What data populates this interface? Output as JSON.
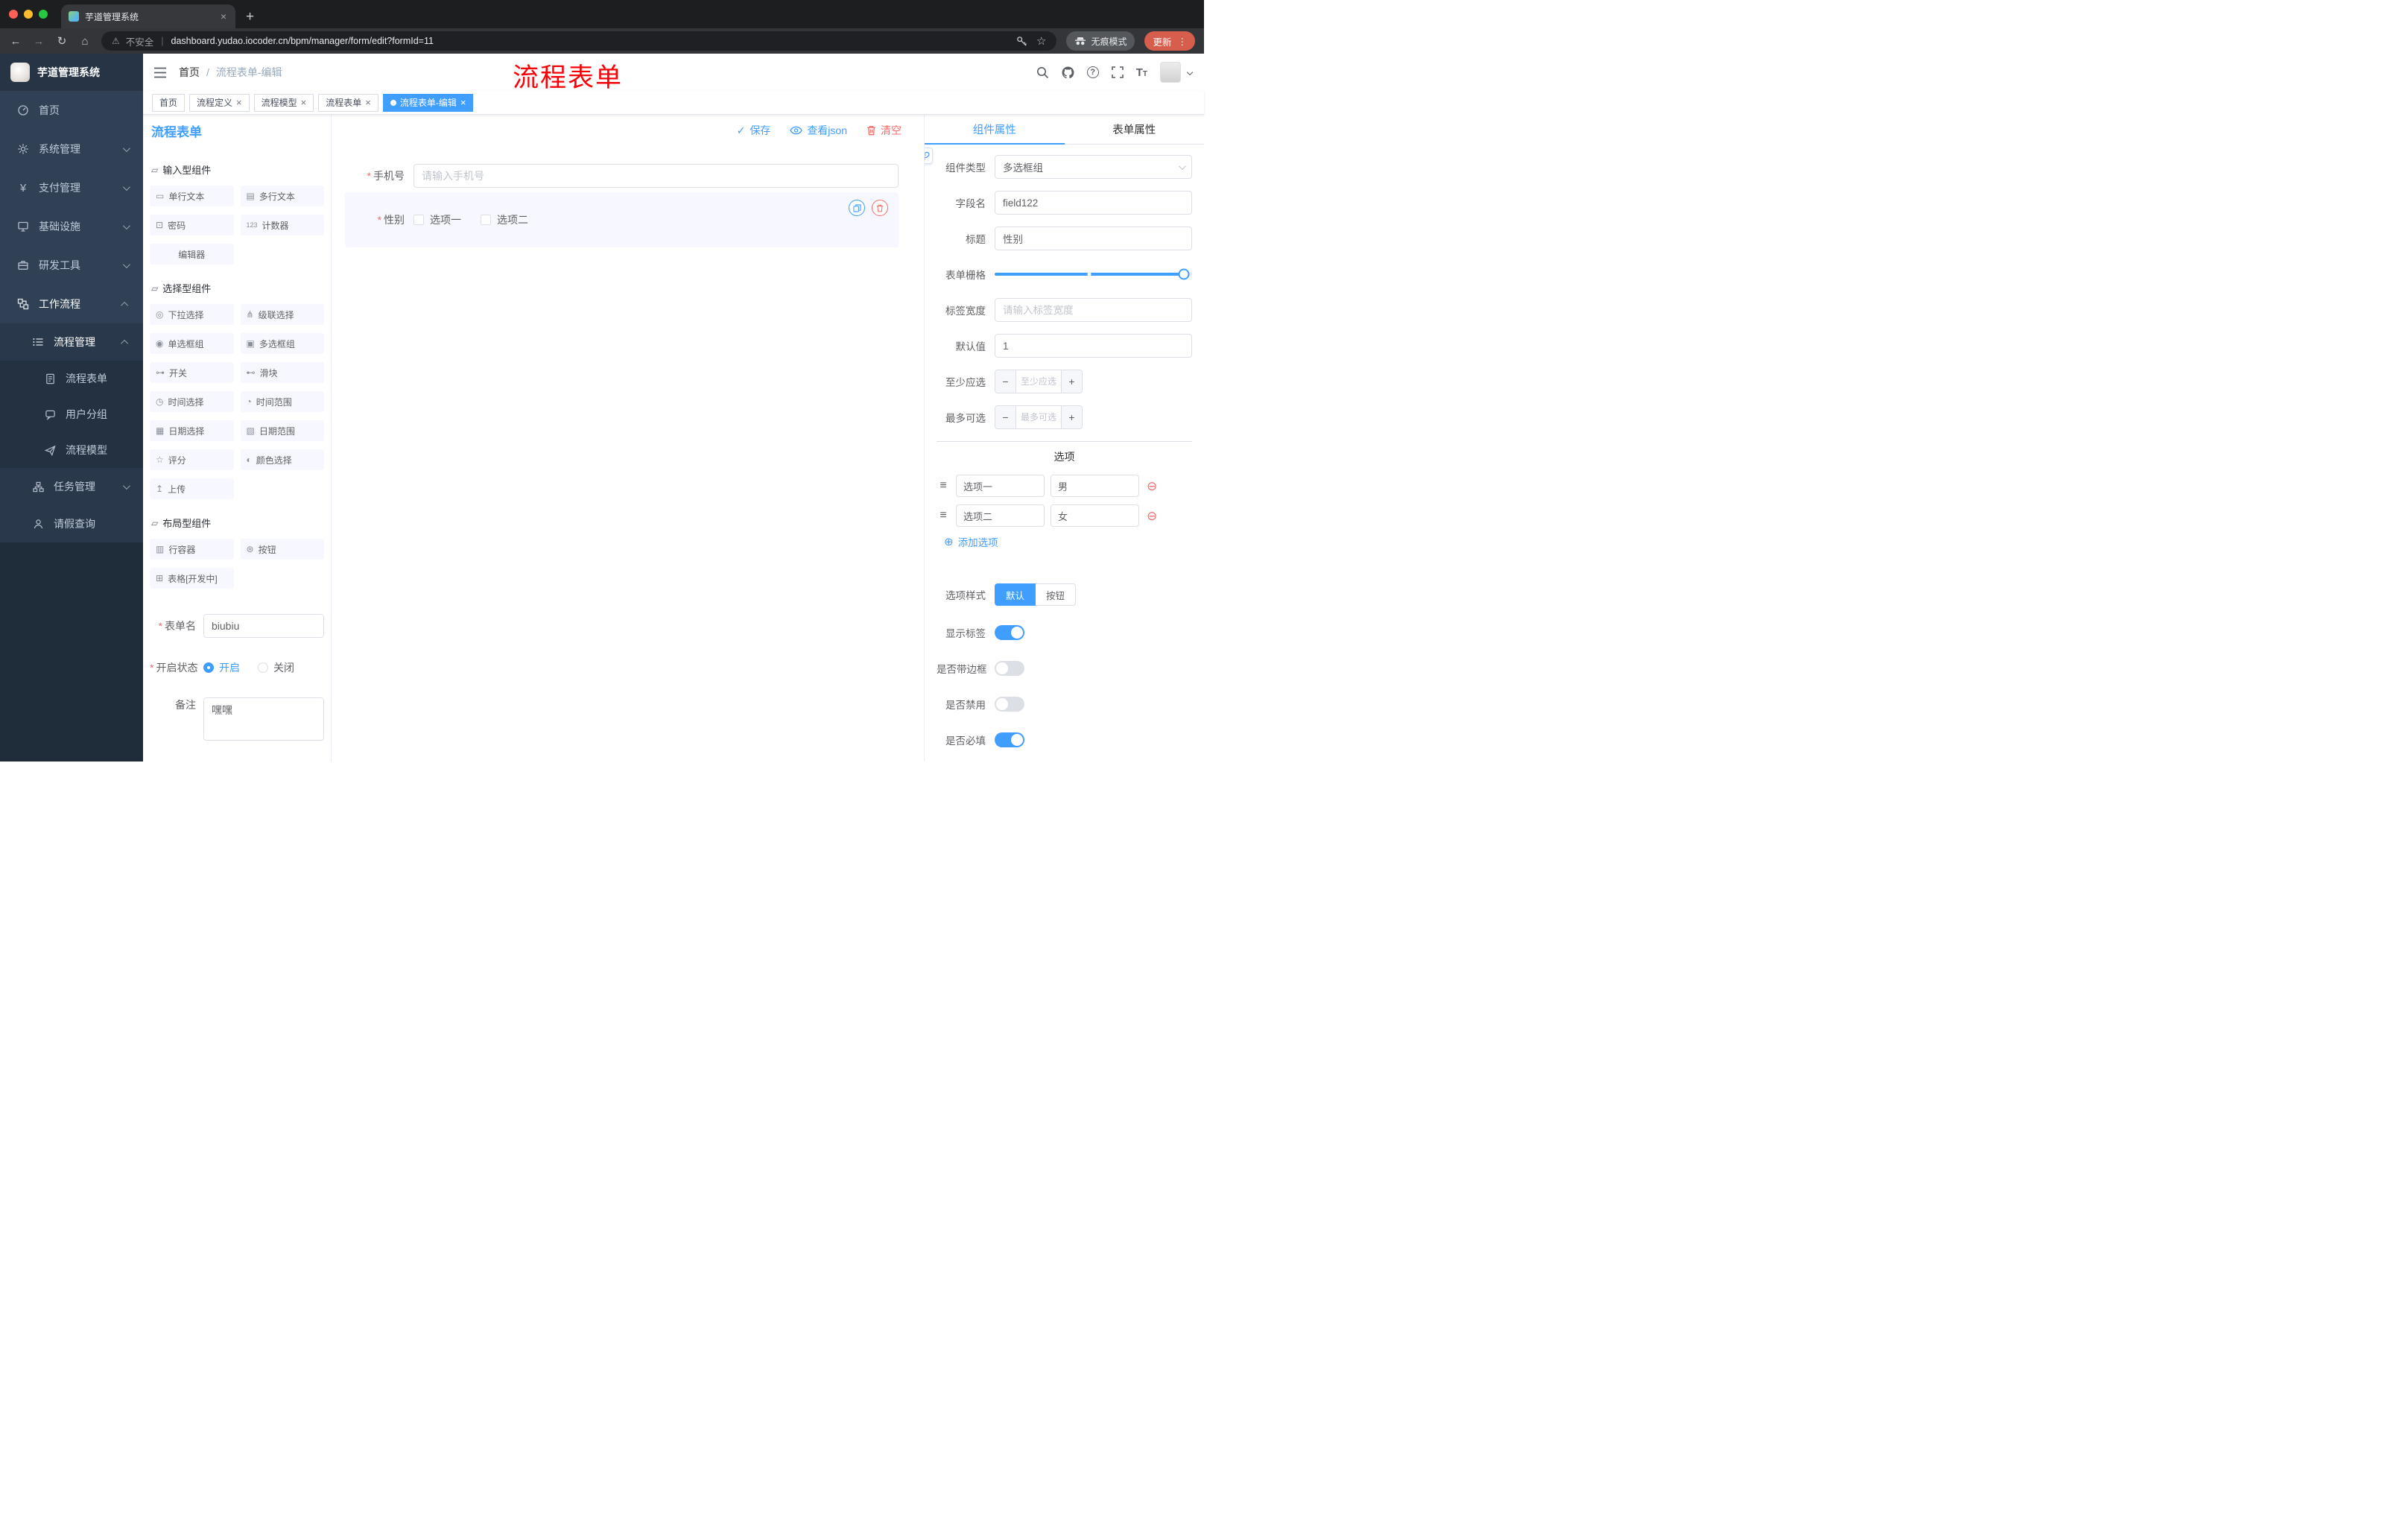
{
  "colors": {
    "accent": "#409eff",
    "danger": "#f56c6c",
    "sidebar_bg": "#304156",
    "tag_active": "#409eff",
    "update_pill": "#d75d4c",
    "annotation": "#fb0007"
  },
  "annotation_text": "流程表单",
  "browser": {
    "tab_title": "芋道管理系统",
    "security_label": "不安全",
    "url": "dashboard.yudao.iocoder.cn/bpm/manager/form/edit?formId=11",
    "incognito_label": "无痕模式",
    "update_label": "更新"
  },
  "sidebar": {
    "logo_title": "芋道管理系统",
    "menu": [
      {
        "label": "首页"
      },
      {
        "label": "系统管理"
      },
      {
        "label": "支付管理"
      },
      {
        "label": "基础设施"
      },
      {
        "label": "研发工具"
      },
      {
        "label": "工作流程"
      },
      {
        "label": "流程管理"
      },
      {
        "label": "流程表单"
      },
      {
        "label": "用户分组"
      },
      {
        "label": "流程模型"
      },
      {
        "label": "任务管理"
      },
      {
        "label": "请假查询"
      }
    ]
  },
  "header": {
    "breadcrumb_home": "首页",
    "separator": "/",
    "breadcrumb_current": "流程表单-编辑"
  },
  "tags": [
    {
      "label": "首页"
    },
    {
      "label": "流程定义"
    },
    {
      "label": "流程模型"
    },
    {
      "label": "流程表单"
    },
    {
      "label": "流程表单-编辑",
      "active": true
    }
  ],
  "designer": {
    "panel_title": "流程表单",
    "actions": {
      "save": "保存",
      "view_json": "查看json",
      "clear": "清空"
    },
    "groups": [
      {
        "title": "输入型组件",
        "items": [
          "单行文本",
          "多行文本",
          "密码",
          "计数器",
          "编辑器"
        ]
      },
      {
        "title": "选择型组件",
        "items": [
          "下拉选择",
          "级联选择",
          "单选框组",
          "多选框组",
          "开关",
          "滑块",
          "时间选择",
          "时间范围",
          "日期选择",
          "日期范围",
          "评分",
          "颜色选择",
          "上传"
        ]
      },
      {
        "title": "布局型组件",
        "items": [
          "行容器",
          "按钮",
          "表格[开发中]"
        ]
      }
    ],
    "meta_form": {
      "name_label": "表单名",
      "name_value": "biubiu",
      "status_label": "开启状态",
      "status_on": "开启",
      "status_off": "关闭",
      "remark_label": "备注",
      "remark_value": "嘿嘿"
    },
    "canvas": {
      "phone": {
        "label": "手机号",
        "placeholder": "请输入手机号"
      },
      "gender": {
        "label": "性别",
        "option1": "选项一",
        "option2": "选项二"
      }
    }
  },
  "props": {
    "tab_component": "组件属性",
    "tab_form": "表单属性",
    "rows": {
      "type_label": "组件类型",
      "type_value": "多选框组",
      "field_label": "字段名",
      "field_value": "field122",
      "title_label": "标题",
      "title_value": "性别",
      "grid_label": "表单栅格",
      "label_width_label": "标签宽度",
      "label_width_placeholder": "请输入标签宽度",
      "default_label": "默认值",
      "default_value": "1",
      "min_label": "至少应选",
      "min_placeholder": "至少应选",
      "max_label": "最多可选",
      "max_placeholder": "最多可选"
    },
    "options_divider": "选项",
    "options": [
      {
        "label": "选项一",
        "value": "男"
      },
      {
        "label": "选项二",
        "value": "女"
      }
    ],
    "add_option": "添加选项",
    "style_label": "选项样式",
    "style_default": "默认",
    "style_button": "按钮",
    "switches": [
      {
        "label": "显示标签",
        "on": true
      },
      {
        "label": "是否带边框",
        "on": false
      },
      {
        "label": "是否禁用",
        "on": false
      },
      {
        "label": "是否必填",
        "on": true
      }
    ]
  },
  "icons": {
    "section": "▱",
    "single_line_text": "▭",
    "textarea": "▤",
    "password": "⊡",
    "counter": "123",
    "select": "◎",
    "cascader": "⋔",
    "radio_group": "◉",
    "checkbox_group": "▣",
    "switch": "⊶",
    "slider": "⊷",
    "time": "◷",
    "time_range": "◔",
    "date": "▦",
    "date_range": "▧",
    "rate": "☆",
    "color": "◐",
    "upload": "↥",
    "row_container": "▥",
    "button": "⊛",
    "table": "⊞",
    "drag": "≡",
    "remove": "⊖",
    "add": "⊕",
    "check": "✓",
    "back": "←",
    "forward": "→",
    "reload": "↻",
    "home": "⌂",
    "warning": "⚠",
    "star": "☆",
    "kebab": "⋮",
    "plus": "+",
    "close": "×",
    "help": "?",
    "yen": "¥",
    "font_large": "T",
    "font_small": "T"
  }
}
